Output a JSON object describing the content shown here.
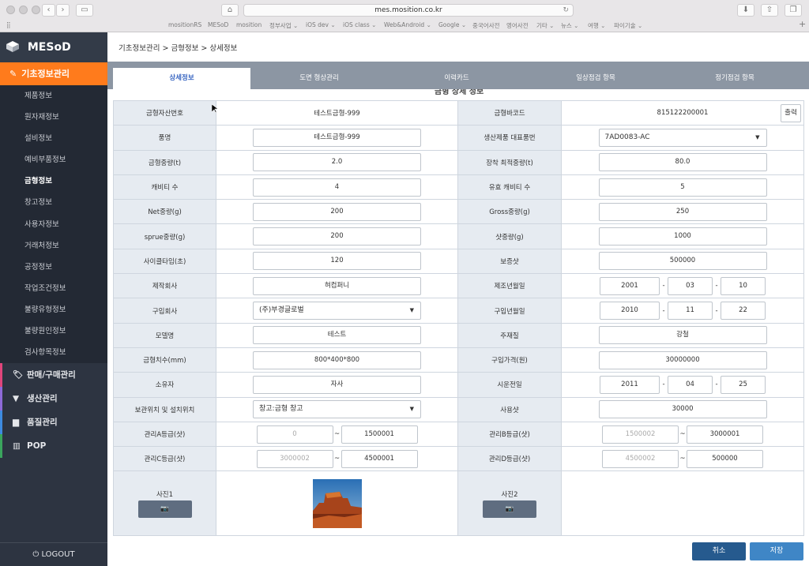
{
  "browser": {
    "url": "mes.mosition.co.kr",
    "bookmarks": [
      "mositionRS",
      "MESoD",
      "mosition",
      "정부사업 ⌄",
      "iOS dev ⌄",
      "iOS class ⌄",
      "Web&Android ⌄",
      "Google ⌄",
      "중국어사전",
      "영어사전",
      "기타 ⌄",
      "뉴스 ⌄",
      "여행 ⌄",
      "파이기술 ⌄"
    ]
  },
  "sidebar": {
    "logo": "MESoD",
    "active_menu": "기초정보관리",
    "items": [
      "제품정보",
      "원자재정보",
      "설비정보",
      "예비부품정보",
      "금형정보",
      "창고정보",
      "사용자정보",
      "거래처정보",
      "공정정보",
      "작업조건정보",
      "불량유형정보",
      "불량원인정보",
      "검사항목정보"
    ],
    "active_item": "금형정보",
    "main_menus": [
      {
        "label": "판매/구매관리",
        "icon": "tag-icon",
        "color": "#e0457b"
      },
      {
        "label": "생산관리",
        "icon": "filter-icon",
        "color": "#8e6ad8"
      },
      {
        "label": "품질관리",
        "icon": "bar-chart-icon",
        "color": "#3d8be0"
      },
      {
        "label": "POP",
        "icon": "barcode-icon",
        "color": "#3aa55d"
      }
    ],
    "logout": "LOGOUT"
  },
  "breadcrumb": "기초정보관리 > 금형정보 > 상세정보",
  "tabs": [
    "상세정보",
    "도면 형상관리",
    "이력카드",
    "일상점검 항목",
    "정기점검 항목"
  ],
  "active_tab": "상세정보",
  "section_title": "금형 상세 정보",
  "fields": {
    "asset_no_label": "금형자산번호",
    "asset_no": "테스트금형-999",
    "barcode_label": "금형바코드",
    "barcode": "815122200001",
    "print_label": "출력",
    "product_label": "품명",
    "product": "테스트금형-999",
    "rep_part_label": "생산제품 대표품번",
    "rep_part": "7AD0083-AC",
    "weight_label": "금형중량(t)",
    "weight": "2.0",
    "mount_weight_label": "장착 최적중량(t)",
    "mount_weight": "80.0",
    "cavity_label": "캐비티 수",
    "cavity": "4",
    "eff_cavity_label": "유효 캐비티 수",
    "eff_cavity": "5",
    "net_label": "Net중량(g)",
    "net": "200",
    "gross_label": "Gross중량(g)",
    "gross": "250",
    "sprue_label": "sprue중량(g)",
    "sprue": "200",
    "shot_weight_label": "샷중량(g)",
    "shot_weight": "1000",
    "cycle_label": "사이클타임(초)",
    "cycle": "120",
    "guarantee_label": "보증샷",
    "guarantee": "500000",
    "maker_label": "제작회사",
    "maker": "혀컴퍼니",
    "mfg_date_label": "제조년월일",
    "mfg_y": "2001",
    "mfg_m": "03",
    "mfg_d": "10",
    "buyer_label": "구입회사",
    "buyer": "(주)부경글로벌",
    "buy_date_label": "구입년월일",
    "buy_y": "2010",
    "buy_m": "11",
    "buy_d": "22",
    "model_label": "모델명",
    "model": "테스트",
    "material_label": "주재질",
    "material": "강철",
    "size_label": "금형치수(mm)",
    "size": "800*400*800",
    "price_label": "구입가격(원)",
    "price": "30000000",
    "owner_label": "소유자",
    "owner": "자사",
    "trial_label": "시운전일",
    "trial_y": "2011",
    "trial_m": "04",
    "trial_d": "25",
    "location_label": "보관위치 및 설치위치",
    "location": "창고:금형 창고",
    "used_label": "사용샷",
    "used": "30000",
    "gradeA_label": "관리A등급(샷)",
    "gradeA_from": "0",
    "gradeA_to": "1500001",
    "gradeB_label": "관리B등급(샷)",
    "gradeB_from": "1500002",
    "gradeB_to": "3000001",
    "gradeC_label": "관리C등급(샷)",
    "gradeC_from": "3000002",
    "gradeC_to": "4500001",
    "gradeD_label": "관리D등급(샷)",
    "gradeD_from": "4500002",
    "gradeD_to": "500000",
    "photo1_label": "사진1",
    "photo2_label": "사진2",
    "tilde": "~",
    "dash": "-"
  },
  "buttons": {
    "cancel": "취소",
    "save": "저장"
  }
}
